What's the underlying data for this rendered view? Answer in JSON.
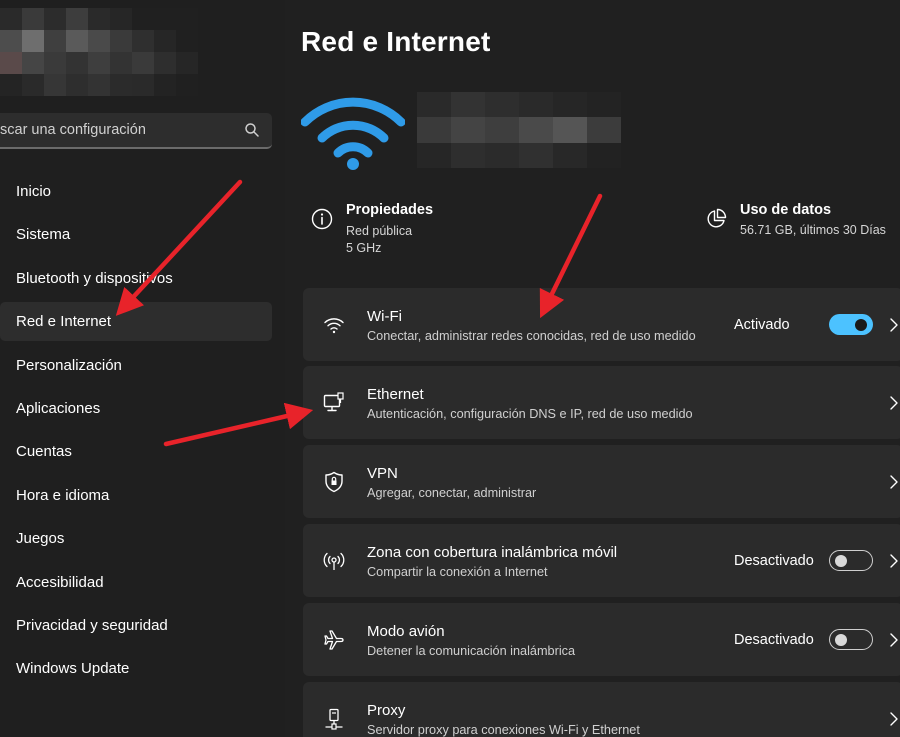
{
  "sidebar": {
    "search_placeholder": "scar una configuración",
    "items": [
      {
        "label": "Inicio",
        "active": false
      },
      {
        "label": "Sistema",
        "active": false
      },
      {
        "label": "Bluetooth y dispositivos",
        "active": false
      },
      {
        "label": "Red e Internet",
        "active": true
      },
      {
        "label": "Personalización",
        "active": false
      },
      {
        "label": "Aplicaciones",
        "active": false
      },
      {
        "label": "Cuentas",
        "active": false
      },
      {
        "label": "Hora e idioma",
        "active": false
      },
      {
        "label": "Juegos",
        "active": false
      },
      {
        "label": "Accesibilidad",
        "active": false
      },
      {
        "label": "Privacidad y seguridad",
        "active": false
      },
      {
        "label": "Windows Update",
        "active": false
      }
    ]
  },
  "main": {
    "title": "Red e Internet",
    "properties": {
      "title": "Propiedades",
      "line1": "Red pública",
      "line2": "5 GHz"
    },
    "usage": {
      "title": "Uso de datos",
      "detail": "56.71 GB, últimos 30 Días"
    },
    "cards": [
      {
        "icon": "wifi-icon",
        "title": "Wi-Fi",
        "sub": "Conectar, administrar redes conocidas, red de uso medido",
        "status": "Activado",
        "toggle": "on"
      },
      {
        "icon": "ethernet-icon",
        "title": "Ethernet",
        "sub": "Autenticación, configuración DNS e IP, red de uso medido",
        "status": "",
        "toggle": "none"
      },
      {
        "icon": "vpn-shield-icon",
        "title": "VPN",
        "sub": "Agregar, conectar, administrar",
        "status": "",
        "toggle": "none"
      },
      {
        "icon": "hotspot-icon",
        "title": "Zona con cobertura inalámbrica móvil",
        "sub": "Compartir la conexión a Internet",
        "status": "Desactivado",
        "toggle": "off"
      },
      {
        "icon": "airplane-icon",
        "title": "Modo avión",
        "sub": "Detener la comunicación inalámbrica",
        "status": "Desactivado",
        "toggle": "off"
      },
      {
        "icon": "proxy-icon",
        "title": "Proxy",
        "sub": "Servidor proxy para conexiones Wi-Fi y Ethernet",
        "status": "",
        "toggle": "none"
      }
    ]
  },
  "colors": {
    "background": "#202020",
    "card": "#2b2b2b",
    "accent": "#4cc2ff",
    "hero_wifi": "#2f9be8",
    "annotation_arrow": "#e8232a"
  }
}
